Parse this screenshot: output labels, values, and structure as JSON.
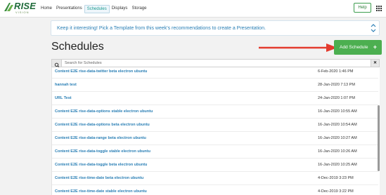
{
  "colors": {
    "accent": "#4caf50",
    "link": "#2a7fb5",
    "arrow": "#e33b2e",
    "brand": "#1f6b3a"
  },
  "brand": {
    "logo_text": "RISE",
    "logo_sub": "VISION"
  },
  "nav": {
    "items": [
      {
        "label": "Home",
        "active": false
      },
      {
        "label": "Presentations",
        "active": false
      },
      {
        "label": "Schedules",
        "active": true
      },
      {
        "label": "Displays",
        "active": false
      },
      {
        "label": "Storage",
        "active": false
      }
    ],
    "help_label": "Help",
    "apps_icon": "grid-icon"
  },
  "banner": {
    "text": "Keep it interesting! Pick a Template from this week's recommendations to create a Presentation.",
    "icon": "chevron-up-down-icon"
  },
  "page": {
    "title": "Schedules",
    "add_label": "Add Schedule",
    "add_icon": "plus-icon"
  },
  "search": {
    "placeholder": "Search for Schedules",
    "value": "",
    "icon": "search-icon",
    "clear_label": "✕"
  },
  "schedules": [
    {
      "name": "Content E2E rise-data-twitter beta electron ubuntu",
      "date": "6-Feb-2020 1:46 PM"
    },
    {
      "name": "hannah test",
      "date": "28-Jan-2020 7:13 PM"
    },
    {
      "name": "URL Test",
      "date": "24-Jan-2020 1:07 PM"
    },
    {
      "name": "Content E2E rise-data-options stable electron ubuntu",
      "date": "16-Jan-2020 10:55 AM"
    },
    {
      "name": "Content E2E rise-data-options beta electron ubuntu",
      "date": "16-Jan-2020 10:54 AM"
    },
    {
      "name": "Content E2E rise-data-range beta electron ubuntu",
      "date": "16-Jan-2020 10:27 AM"
    },
    {
      "name": "Content E2E rise-data-toggle stable electron ubuntu",
      "date": "16-Jan-2020 10:26 AM"
    },
    {
      "name": "Content E2E rise-data-toggle beta electron ubuntu",
      "date": "16-Jan-2020 10:25 AM"
    },
    {
      "name": "Content E2E rise-time-date beta electron ubuntu",
      "date": "4-Dec-2019 3:23 PM"
    },
    {
      "name": "Content E2E rise-time-date stable electron ubuntu",
      "date": "4-Dec-2019 3:22 PM"
    }
  ]
}
